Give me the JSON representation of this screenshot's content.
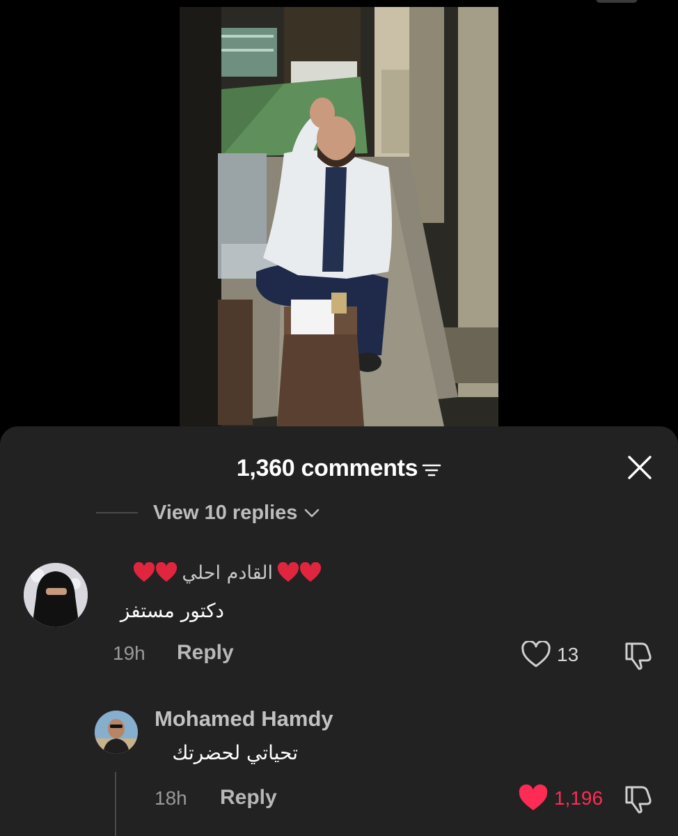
{
  "video": {
    "description_icon": "video-frame"
  },
  "comments_header": {
    "title": "1,360 comments",
    "sort_icon": "sort-lines-icon",
    "close_icon": "close-icon"
  },
  "view_replies": {
    "label": "View 10 replies",
    "icon": "chevron-down-icon"
  },
  "comments": [
    {
      "username": "القادم احلي",
      "username_emoji": "heart-emoji",
      "text": "دكتور مستفز",
      "time": "19h",
      "reply_label": "Reply",
      "likes": "13",
      "liked": false
    },
    {
      "username": "Mohamed Hamdy",
      "text": "تحياتي لحضرتك",
      "time": "18h",
      "reply_label": "Reply",
      "likes": "1,196",
      "liked": true
    }
  ],
  "colors": {
    "sheet_bg": "#222222",
    "liked_red": "#fe2c55",
    "muted_text": "#9a9a9a"
  }
}
